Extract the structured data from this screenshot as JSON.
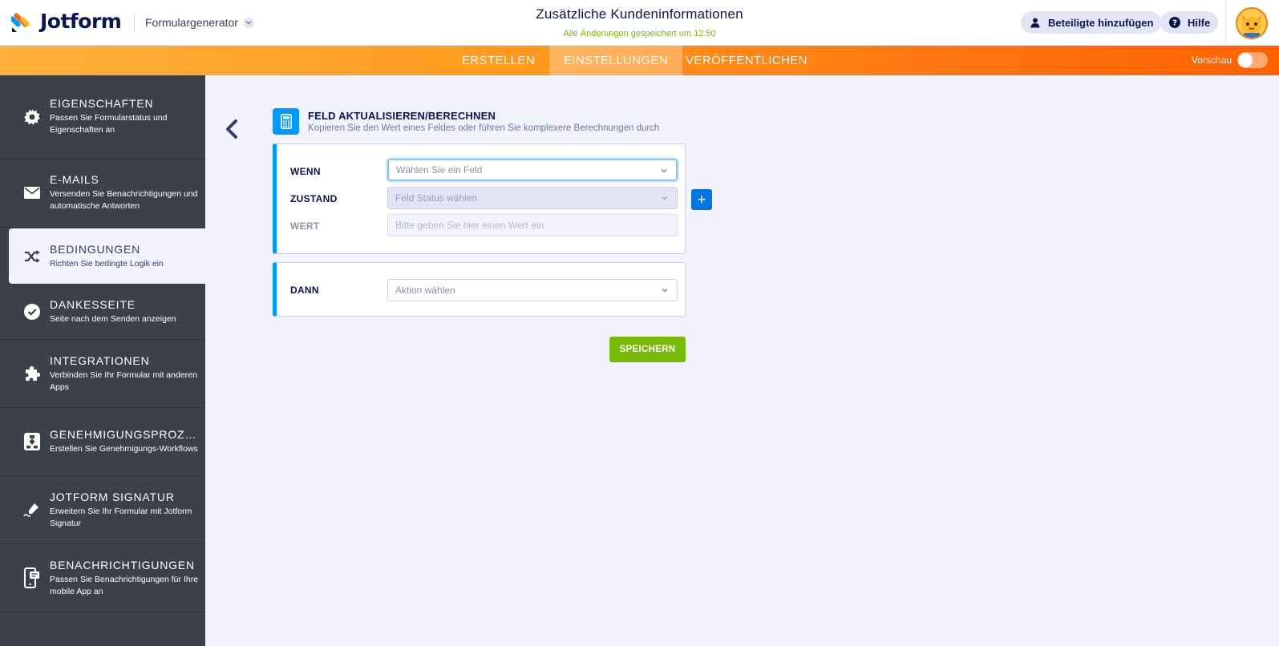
{
  "header": {
    "brand": "Jotform",
    "form_generator": "Formulargenerator",
    "form_title": "Zusätzliche Kundeninformationen",
    "save_status": "Alle Änderungen gespeichert um 12:50",
    "invite_label": "Beteiligte hinzufügen",
    "help_label": "Hilfe"
  },
  "nav": {
    "tabs": [
      {
        "label": "ERSTELLEN"
      },
      {
        "label": "EINSTELLUNGEN"
      },
      {
        "label": "VERÖFFENTLICHEN"
      }
    ],
    "active_tab": "EINSTELLUNGEN",
    "preview_label": "Vorschau",
    "preview_enabled": false
  },
  "sidebar": {
    "items": [
      {
        "title": "EIGENSCHAFTEN",
        "desc": "Passen Sie Formularstatus und Eigenschaften an",
        "icon": "gear-icon"
      },
      {
        "title": "E-MAILS",
        "desc": "Versenden Sie Benachrichtigungen und automatische Antworten",
        "icon": "envelope-icon"
      },
      {
        "title": "BEDINGUNGEN",
        "desc": "Richten Sie bedingte Logik ein",
        "icon": "shuffle-icon"
      },
      {
        "title": "DANKESSEITE",
        "desc": "Seite nach dem Senden anzeigen",
        "icon": "check-circle-icon"
      },
      {
        "title": "INTEGRATIONEN",
        "desc": "Verbinden Sie Ihr Formular mit anderen Apps",
        "icon": "puzzle-icon"
      },
      {
        "title": "GENEHMIGUNGSPROZES...",
        "desc": "Erstellen Sie Genehmigungs-Workflows",
        "icon": "workflow-icon"
      },
      {
        "title": "JOTFORM SIGNATUR",
        "desc": "Erweitern Sie Ihr Formular mit Jotform Signatur",
        "icon": "signature-pen-icon"
      },
      {
        "title": "BENACHRICHTIGUNGEN",
        "desc": "Passen Sie Benachrichtigungen für Ihre mobile App an",
        "icon": "mobile-notification-icon"
      }
    ],
    "active": "BEDINGUNGEN"
  },
  "condition": {
    "title": "FELD AKTUALISIEREN/BERECHNEN",
    "description": "Kopieren Sie den Wert eines Feldes oder führen Sie komplexere Berechnungen durch",
    "if_label": "WENN",
    "if_placeholder": "Wählen Sie ein Feld",
    "state_label": "ZUSTAND",
    "state_placeholder": "Feld Status wählen",
    "value_label": "WERT",
    "value_placeholder": "Bitte geben Sie hier einen Wert ein",
    "then_label": "DANN",
    "then_placeholder": "Aktion wählen",
    "add_label": "+",
    "save_label": "SPEICHERN"
  },
  "colors": {
    "accent_blue": "#0099ff",
    "save_green": "#78bb07",
    "nav_orange": "#ff7510",
    "sidebar_bg": "#3c4149"
  }
}
